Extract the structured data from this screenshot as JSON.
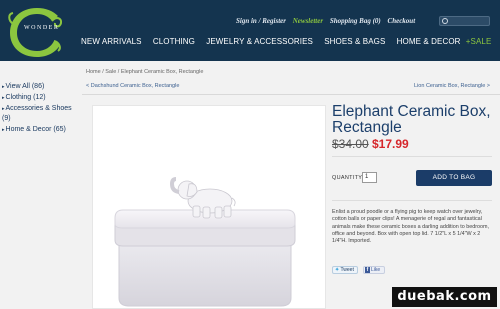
{
  "header": {
    "logo_text": "WONDER",
    "top_links": {
      "signin": "Sign in / Register",
      "newsletter": "Newsletter",
      "bag": "Shopping Bag (0)",
      "checkout": "Checkout"
    },
    "nav": [
      "NEW ARRIVALS",
      "CLOTHING",
      "JEWELRY & ACCESSORIES",
      "SHOES & BAGS",
      "HOME & DECOR"
    ],
    "sale": "+SALE"
  },
  "sidebar": {
    "categories": [
      {
        "label": "View All (86)"
      },
      {
        "label": "Clothing (12)"
      },
      {
        "label": "Accessories & Shoes (9)"
      },
      {
        "label": "Home & Decor (65)"
      }
    ]
  },
  "breadcrumb": "Home / Sale / Elephant Ceramic Box, Rectangle",
  "pager": {
    "prev": "< Dachshund Ceramic Box, Rectangle",
    "next": "Lion Ceramic Box, Rectangle >"
  },
  "product": {
    "title": "Elephant Ceramic Box, Rectangle",
    "old_price": "$34.00",
    "new_price": "$17.99",
    "quantity_label": "QUANTITY",
    "quantity": "1",
    "add_button": "ADD TO BAG",
    "description": "Enlist a proud poodle or a flying pig to keep watch over jewelry, cotton balls or paper clips! A menagerie of regal and fantastical animals make these ceramic boxes a darling addition to bedroom, office and beyond. Box with open top lid. 7 1/2\"L x 5 1/4\"W x 2 1/4\"H. Imported.",
    "tweet_label": "Tweet",
    "like_label": "Like"
  },
  "watermark": "duebak.com",
  "colors": {
    "header_bg": "#14344f",
    "accent_green": "#8cc63f",
    "title_blue": "#1c3f6b",
    "sale_red": "#d6262b",
    "button_blue": "#1b3c68"
  }
}
